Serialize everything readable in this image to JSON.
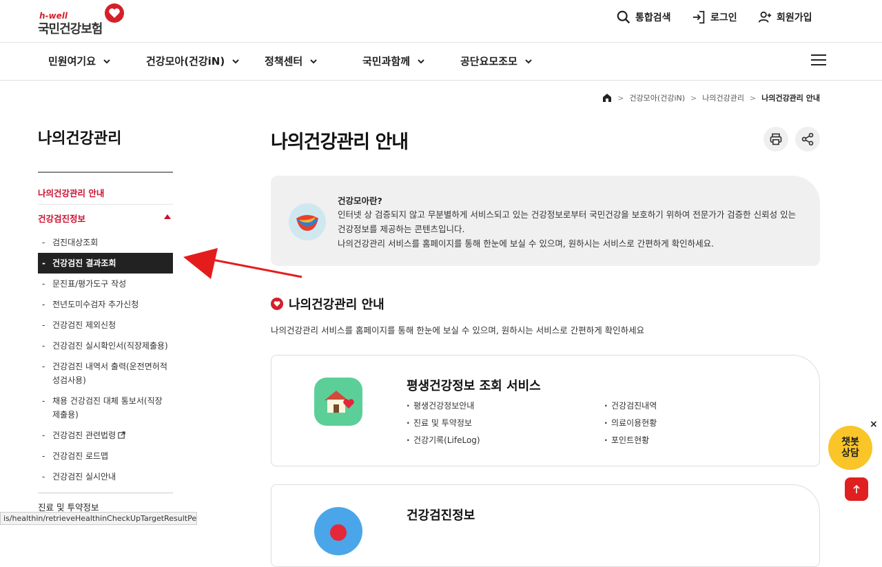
{
  "header": {
    "logo_small": "h-well",
    "logo_main": "국민건강보험",
    "utils": [
      {
        "label": "통합검색",
        "icon": "search-icon"
      },
      {
        "label": "로그인",
        "icon": "login-icon"
      },
      {
        "label": "회원가입",
        "icon": "user-add-icon"
      }
    ]
  },
  "gnb": {
    "items": [
      "민원여기요",
      "건강모아(건강iN)",
      "정책센터",
      "국민과함께",
      "공단요모조모"
    ]
  },
  "breadcrumb": {
    "home_icon": "home-icon",
    "items": [
      "건강모아(건강iN)",
      "나의건강관리",
      "나의건강관리 안내"
    ]
  },
  "lnb": {
    "title": "나의건강관리",
    "item_guide": "나의건강관리 안내",
    "item_checkup": "건강검진정보",
    "subitems": [
      "검진대상조회",
      "건강검진 결과조회",
      "문진표/평가도구 작성",
      "전년도미수검자 추가신청",
      "건강검진 제외신청",
      "건강검진 실시확인서(직장제출용)",
      "건강검진 내역서 출력(운전면허적성검사용)",
      "채용 건강검진 대체 통보서(직장제출용)",
      "건강검진 관련법령",
      "건강검진 로드맵",
      "건강검진 실시안내"
    ],
    "next_item": "진료 및 투약정보"
  },
  "status_bar": "is/healthin/retrieveHealthinCheckUpTargetResultPerson.do",
  "main": {
    "title": "나의건강관리 안내",
    "info": {
      "title": "건강모아란?",
      "body": "인터넷 상 검증되지 않고 무분별하게 서비스되고 있는 건강정보로부터 국민건강을 보호하기 위하여 전문가가 검증한 신뢰성 있는 건강정보를 제공하는 콘텐츠입니다.\n나의건강관리 서비스를 홈페이지를 통해 한눈에 보실 수 있으며, 원하시는 서비스로 간편하게 확인하세요."
    },
    "section_title": "나의건강관리 안내",
    "section_desc": "나의건강관리 서비스를 홈페이지를 통해 한눈에 보실 수 있으며, 원하시는 서비스로 간편하게 확인하세요",
    "card1": {
      "title": "평생건강정보 조회 서비스",
      "items": [
        "평생건강정보안내",
        "건강검진내역",
        "진료 및 투약정보",
        "의료이용현황",
        "건강기록(LifeLog)",
        "포인트현황"
      ]
    },
    "card2": {
      "title": "건강검진정보"
    }
  },
  "chatbot": {
    "line1": "챗봇",
    "line2": "상담",
    "close": "×"
  },
  "colors": {
    "accent": "#c8102e",
    "chatbot": "#f9c528",
    "top_button": "#e02020"
  }
}
